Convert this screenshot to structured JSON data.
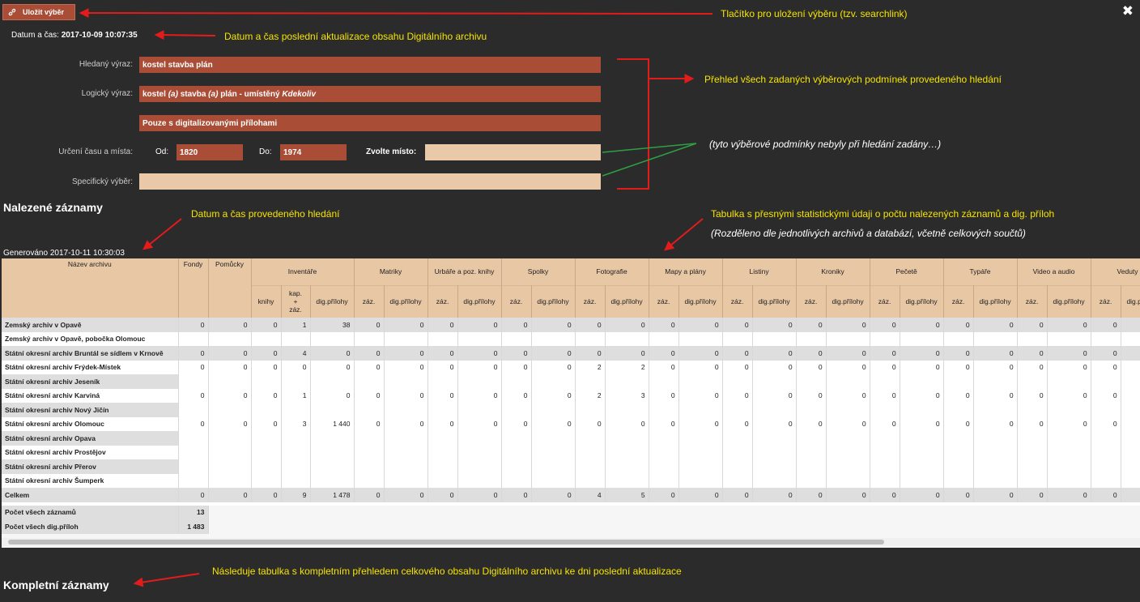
{
  "toolbar": {
    "save_label": "Uložit výběr",
    "close_glyph": "✖"
  },
  "datetime": {
    "label": "Datum a čas:",
    "value": "2017-10-09 10:07:35"
  },
  "annotations": {
    "save": "Tlačítko pro uložení výběru (tzv. searchlink)",
    "datetime": "Datum a čas poslední aktualizace obsahu Digitálního archivu",
    "conditions": "Přehled všech zadaných výběrových podmínek provedeného hledání",
    "not_set": "(tyto výběrové podmínky nebyly při hledání zadány…)",
    "search_time": "Datum a čas provedeného hledání",
    "table1": "Tabulka s přesnými statistickými údaji o počtu nalezených záznamů a dig. příloh",
    "table2": "(Rozděleno dle jednotlivých archivů a databází, včetně celkových součtů)",
    "complete": "Následuje tabulka s kompletním přehledem celkového obsahu Digitálního archivu ke dni poslední aktualizace"
  },
  "filters": {
    "search_label": "Hledaný výraz:",
    "search_value": "kostel stavba plán",
    "logic_label": "Logický výraz:",
    "logic_parts": [
      "kostel ",
      "(a)",
      " stavba ",
      "(a)",
      " plán - umístěný ",
      "Kdekoliv"
    ],
    "digital_only": "Pouze s digitalizovanými přílohami",
    "time_place_label": "Určení času a místa:",
    "from_label": "Od:",
    "from_value": "1820",
    "to_label": "Do:",
    "to_value": "1974",
    "place_label": "Zvolte místo:",
    "place_value": "",
    "specific_label": "Specifický výběr:",
    "specific_value": ""
  },
  "headings": {
    "found": "Nalezené záznamy",
    "generated": "Generováno 2017-10-11 10:30:03",
    "complete": "Kompletní záznamy"
  },
  "table": {
    "col_archive": "Název archivu",
    "col_fonds": "Fondy",
    "col_aids": "Pomůcky",
    "groups": [
      {
        "name": "Inventáře",
        "subs": [
          "knihy",
          "kap.\n+\nzáz.",
          "dig.přílohy"
        ]
      },
      {
        "name": "Matriky",
        "subs": [
          "záz.",
          "dig.přílohy"
        ]
      },
      {
        "name": "Urbáře a poz. knihy",
        "subs": [
          "záz.",
          "dig.přílohy"
        ]
      },
      {
        "name": "Spolky",
        "subs": [
          "záz.",
          "dig.přílohy"
        ]
      },
      {
        "name": "Fotografie",
        "subs": [
          "záz.",
          "dig.přílohy"
        ]
      },
      {
        "name": "Mapy a plány",
        "subs": [
          "záz.",
          "dig.přílohy"
        ]
      },
      {
        "name": "Listiny",
        "subs": [
          "záz.",
          "dig.přílohy"
        ]
      },
      {
        "name": "Kroniky",
        "subs": [
          "záz.",
          "dig.přílohy"
        ]
      },
      {
        "name": "Pečetě",
        "subs": [
          "záz.",
          "dig.přílohy"
        ]
      },
      {
        "name": "Typáře",
        "subs": [
          "záz.",
          "dig.přílohy"
        ]
      },
      {
        "name": "Video a audio",
        "subs": [
          "záz.",
          "dig.přílohy"
        ]
      },
      {
        "name": "Veduty",
        "subs": [
          "záz.",
          "dig.přílohy"
        ]
      }
    ],
    "rows": [
      {
        "name": "Zemský archiv v Opavě",
        "values": [
          "0",
          "0",
          "0",
          "1",
          "38",
          "0",
          "0",
          "0",
          "0",
          "0",
          "0",
          "0",
          "0",
          "0",
          "0",
          "0",
          "0",
          "0",
          "0",
          "0",
          "0",
          "0",
          "0",
          "0",
          "0",
          "0"
        ]
      },
      {
        "name": "Zemský archiv v Opavě, pobočka Olomouc",
        "values": []
      },
      {
        "name": "Státní okresní archiv Bruntál se sídlem v Krnově",
        "values": [
          "0",
          "0",
          "0",
          "4",
          "0",
          "0",
          "0",
          "0",
          "0",
          "0",
          "0",
          "0",
          "0",
          "0",
          "0",
          "0",
          "0",
          "0",
          "0",
          "0",
          "0",
          "0",
          "0",
          "0",
          "0",
          "0"
        ]
      },
      {
        "name": "Státní okresní archiv Frýdek-Místek",
        "values": [
          "0",
          "0",
          "0",
          "0",
          "0",
          "0",
          "0",
          "0",
          "0",
          "0",
          "0",
          "2",
          "2",
          "0",
          "0",
          "0",
          "0",
          "0",
          "0",
          "0",
          "0",
          "0",
          "0",
          "0",
          "0",
          "0"
        ]
      },
      {
        "name": "Státní okresní archiv Jeseník",
        "values": []
      },
      {
        "name": "Státní okresní archiv Karviná",
        "values": [
          "0",
          "0",
          "0",
          "1",
          "0",
          "0",
          "0",
          "0",
          "0",
          "0",
          "0",
          "2",
          "3",
          "0",
          "0",
          "0",
          "0",
          "0",
          "0",
          "0",
          "0",
          "0",
          "0",
          "0",
          "0",
          "0"
        ]
      },
      {
        "name": "Státní okresní archiv Nový Jičín",
        "values": []
      },
      {
        "name": "Státní okresní archiv Olomouc",
        "values": [
          "0",
          "0",
          "0",
          "3",
          "1 440",
          "0",
          "0",
          "0",
          "0",
          "0",
          "0",
          "0",
          "0",
          "0",
          "0",
          "0",
          "0",
          "0",
          "0",
          "0",
          "0",
          "0",
          "0",
          "0",
          "0",
          "0"
        ]
      },
      {
        "name": "Státní okresní archiv Opava",
        "values": []
      },
      {
        "name": "Státní okresní archiv Prostějov",
        "values": []
      },
      {
        "name": "Státní okresní archiv Přerov",
        "values": []
      },
      {
        "name": "Státní okresní archiv Šumperk",
        "values": []
      }
    ],
    "total": {
      "name": "Celkem",
      "values": [
        "0",
        "0",
        "0",
        "9",
        "1 478",
        "0",
        "0",
        "0",
        "0",
        "0",
        "0",
        "4",
        "5",
        "0",
        "0",
        "0",
        "0",
        "0",
        "0",
        "0",
        "0",
        "0",
        "0",
        "0",
        "0",
        "0"
      ]
    },
    "summary": [
      {
        "name": "Počet všech záznamů",
        "value": "13"
      },
      {
        "name": "Počet všech dig.příloh",
        "value": "1 483"
      }
    ]
  }
}
